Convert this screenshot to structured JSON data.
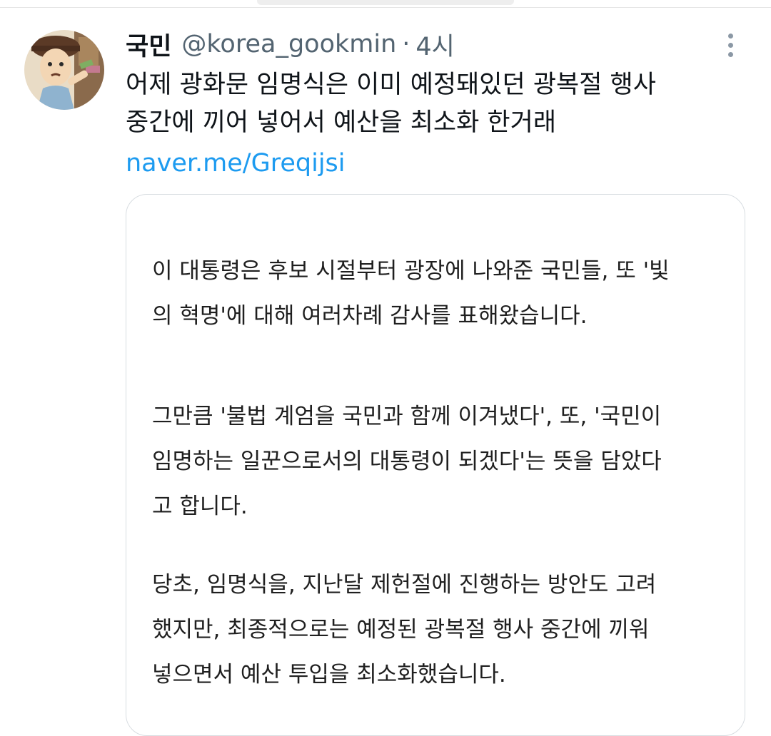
{
  "tweet": {
    "display_name": "국민",
    "handle": "@korea_gookmin",
    "separator": "·",
    "time": "4시",
    "text_lines": [
      "어제 광화문 임명식은 이미 예정돼있던 광복절 행사",
      "중간에 끼어 넣어서 예산을 최소화 한거래"
    ],
    "link": "naver.me/Greqijsi"
  },
  "card": {
    "paragraphs": [
      [
        "이 대통령은 후보 시절부터 광장에 나와준 국민들, 또 '빛",
        "의 혁명'에 대해 여러차례 감사를 표해왔습니다."
      ],
      [
        "그만큼 '불법 계엄을 국민과 함께 이겨냈다', 또, '국민이",
        "임명하는 일꾼으로서의 대통령이 되겠다'는 뜻을 담았다",
        "고 합니다."
      ],
      [
        "당초, 임명식을, 지난달 제헌절에 진행하는 방안도 고려",
        "했지만, 최종적으로는 예정된 광복절 행사 중간에 끼워",
        "넣으면서 예산 투입을 최소화했습니다."
      ]
    ]
  },
  "icons": {
    "avatar": "cartoon-character-avatar",
    "more": "more-options-icon"
  },
  "colors": {
    "link": "#1d9bf0",
    "secondary_text": "#536471",
    "card_border": "#d8dde1"
  }
}
